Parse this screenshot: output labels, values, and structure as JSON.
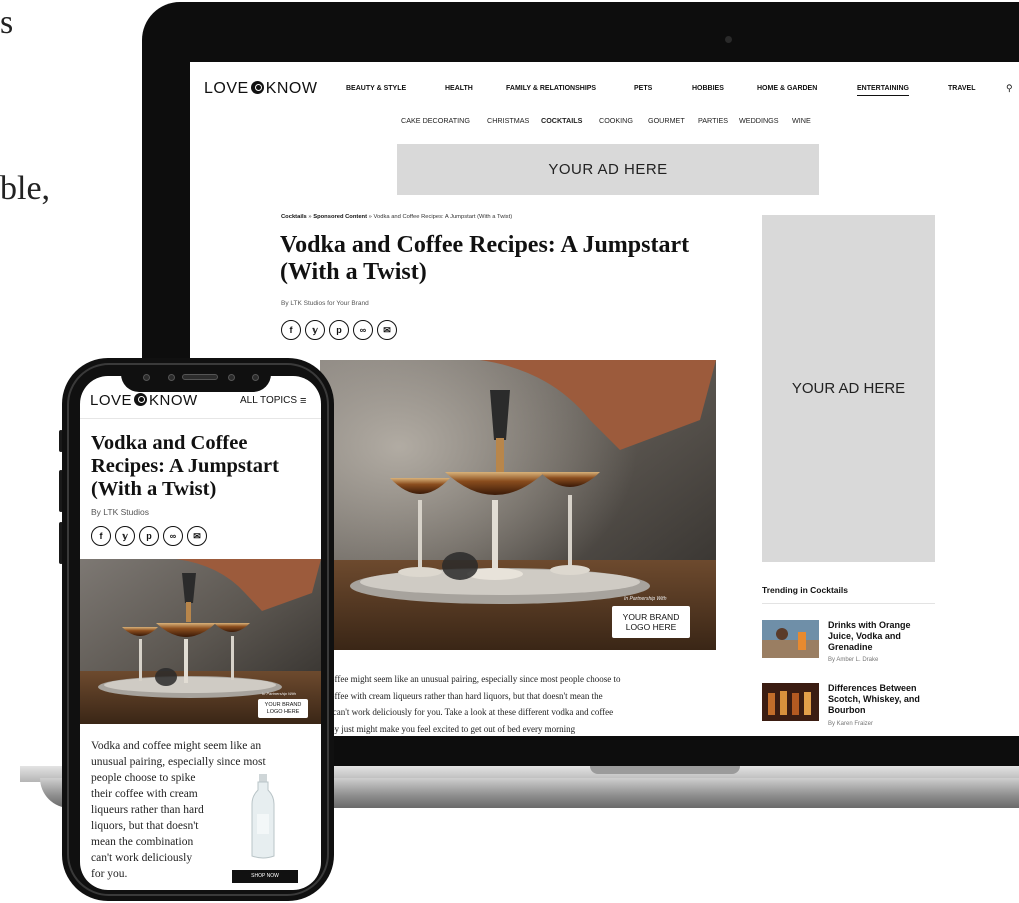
{
  "background_fragments": {
    "left_top": "s",
    "left_mid": "ble,"
  },
  "desktop": {
    "logo": {
      "left": "LOVE",
      "right": "KNOW"
    },
    "topics": [
      "BEAUTY & STYLE",
      "HEALTH",
      "FAMILY & RELATIONSHIPS",
      "PETS",
      "HOBBIES",
      "HOME & GARDEN",
      "ENTERTAINING",
      "TRAVEL"
    ],
    "active_topic": "ENTERTAINING",
    "subtopics": [
      "CAKE DECORATING",
      "CHRISTMAS",
      "COCKTAILS",
      "COOKING",
      "GOURMET",
      "PARTIES",
      "WEDDINGS",
      "WINE"
    ],
    "active_subtopic": "COCKTAILS",
    "ad_top": "YOUR AD HERE",
    "ad_side": "YOUR AD HERE",
    "breadcrumb": {
      "a": "Cocktails",
      "sep1": " » ",
      "b": "Sponsored Content",
      "sep2": " » ",
      "c": "Vodka and Coffee Recipes: A Jumpstart (With a Twist)"
    },
    "title": "Vodka and Coffee Recipes: A Jumpstart (With a Twist)",
    "byline": "By LTK Studios for Your Brand",
    "share_icons": [
      "f",
      "𝕪",
      "p",
      "∞",
      "✉"
    ],
    "hero": {
      "partner": "In Partnership With",
      "brand": "YOUR BRAND LOGO HERE"
    },
    "body_lines": [
      "coffee might seem like an unusual pairing, especially since most people choose to",
      "coffee with cream liqueurs rather than hard liquors, but that doesn't mean the",
      "n can't work deliciously for you. Take a look at these different vodka and coffee",
      "hey just might make you feel excited to get out of bed every morning"
    ],
    "trending": {
      "heading": "Trending in Cocktails",
      "items": [
        {
          "title": "Drinks with Orange Juice, Vodka and Grenadine",
          "author": "By Amber L. Drake"
        },
        {
          "title": "Differences Between Scotch, Whiskey, and Bourbon",
          "author": "By Karen Fraizer"
        }
      ]
    }
  },
  "mobile": {
    "logo": {
      "left": "LOVE",
      "right": "KNOW"
    },
    "all_topics": "ALL TOPICS",
    "menu_icon": "≡",
    "title": "Vodka and Coffee Recipes: A Jumpstart (With a Twist)",
    "byline": "By LTK Studios",
    "hero": {
      "partner": "In Partnership With",
      "brand": "YOUR BRAND LOGO HERE"
    },
    "body_lines": [
      "Vodka and coffee might seem like an",
      "unusual pairing, especially since most",
      "people choose to spike",
      "their coffee with cream",
      "liqueurs rather than hard",
      "liquors, but that doesn't",
      "mean the combination",
      "can't work deliciously",
      "for you."
    ],
    "shop_now": "SHOP NOW"
  }
}
